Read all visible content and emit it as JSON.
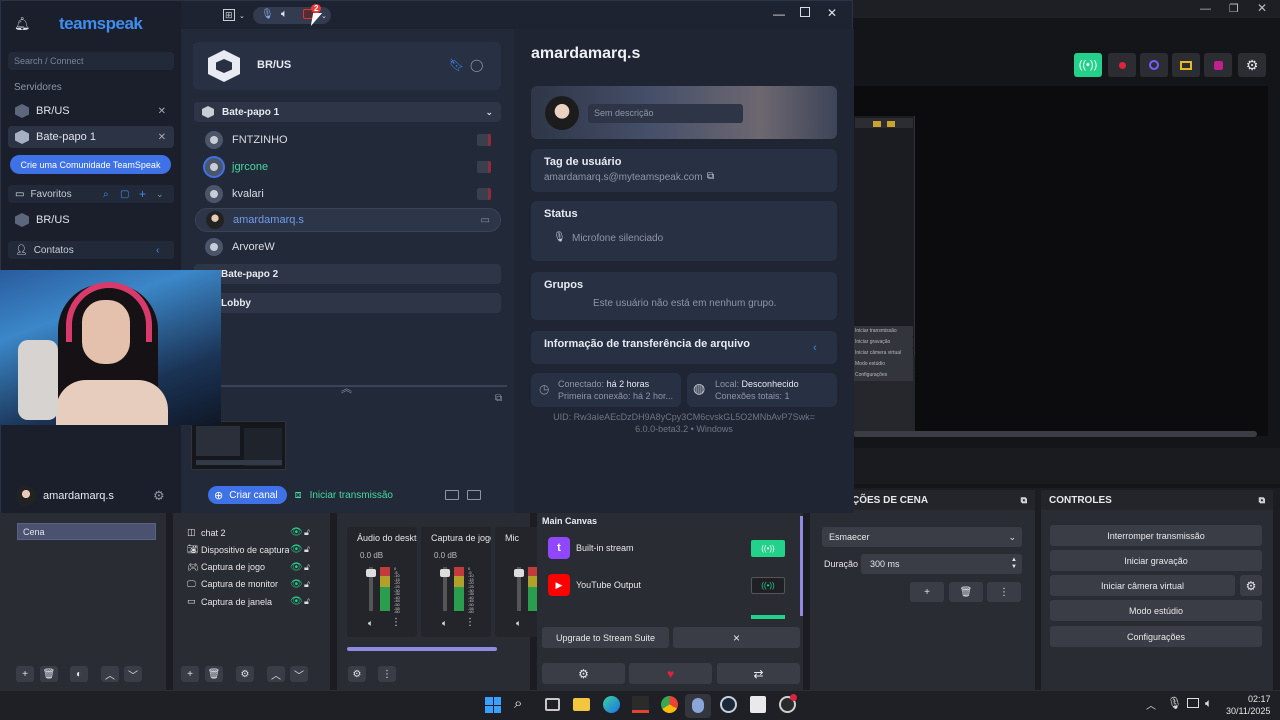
{
  "obs": {
    "scene_dock_title": "ÇÕES DE CENA",
    "controls_title": "CONTROLES",
    "scene_item": "Cena",
    "sources": [
      "chat 2",
      "Dispositivo de captura c",
      "Captura de jogo",
      "Captura de monitor",
      "Captura de janela"
    ],
    "mixer": [
      {
        "name": "Áudio do deskto",
        "db": "0.0 dB"
      },
      {
        "name": "Captura de jogo",
        "db": "0.0 dB"
      },
      {
        "name": "Mic",
        "db": ""
      }
    ],
    "meter_ticks": [
      "0",
      "-5",
      "-10",
      "-15",
      "-20",
      "-25",
      "-30",
      "-35",
      "-40",
      "-45",
      "-50",
      "-55",
      "-60"
    ],
    "canvas_title": "Main Canvas",
    "outputs": [
      {
        "name": "Built-in stream"
      },
      {
        "name": "YouTube Output"
      }
    ],
    "upgrade_label": "Upgrade to Stream Suite",
    "close_x": "×",
    "transition": {
      "selected": "Esmaecer",
      "duration_label": "Duração",
      "duration_value": "300 ms"
    },
    "controls": [
      "Interromper transmissão",
      "Iniciar gravação",
      "Iniciar câmera virtual",
      "Modo estúdio",
      "Configurações"
    ],
    "preview_mini_items": [
      "Iniciar transmissão",
      "Iniciar gravação",
      "Iniciar câmera virtual",
      "Modo estúdio",
      "Configurações"
    ]
  },
  "ts": {
    "logo_text": "teamspeak",
    "search_placeholder": "Search / Connect",
    "servers_title": "Servidores",
    "servers": [
      {
        "name": "BR/US"
      },
      {
        "name": "Bate-papo 1"
      }
    ],
    "create_community": "Crie uma Comunidade TeamSpeak",
    "favorites_title": "Favoritos",
    "favorites": [
      {
        "name": "BR/US"
      }
    ],
    "contacts_title": "Contatos",
    "me_name": "amardamarq.s",
    "server_title": "BR/US",
    "channels": [
      "Bate-papo 1",
      "Bate-papo 2",
      "Lobby"
    ],
    "users": [
      "FNTZINHO",
      "jgrcone",
      "kvalari",
      "amardamarq.s",
      "ArvoreW"
    ],
    "create_channel": "Criar canal",
    "start_stream": "Iniciar transmissão",
    "badge_count": "2",
    "profile": {
      "name": "amardamarq.s",
      "description_placeholder": "Sem descrição",
      "tag_title": "Tag de usuário",
      "tag_value": "amardamarq.s@myteamspeak.com",
      "status_title": "Status",
      "status_value": "Microfone silenciado",
      "groups_title": "Grupos",
      "groups_value": "Este usuário não está em nenhum grupo.",
      "transfer_title": "Informação de transferência de arquivo",
      "connected_label": "Conectado:",
      "connected_value": "há 2 horas",
      "first_conn": "Primeira conexão: há 2 hor...",
      "local_label": "Local:",
      "local_value": "Desconhecido",
      "total_conn": "Conexões totais: 1",
      "uid": "UID: Rw3aIeAEcDzDH9A8yCpy3CM6cvskGL5O2MNbAvP7Swk=",
      "version": "6.0.0-beta3.2 • Windows"
    }
  },
  "taskbar": {
    "time": "02:17",
    "date": "30/11/2025"
  },
  "colors": {
    "accent": "#3e72e6",
    "green": "#47d9a0",
    "obs_green": "#23d18b",
    "ts_bg": "#1d2330"
  }
}
